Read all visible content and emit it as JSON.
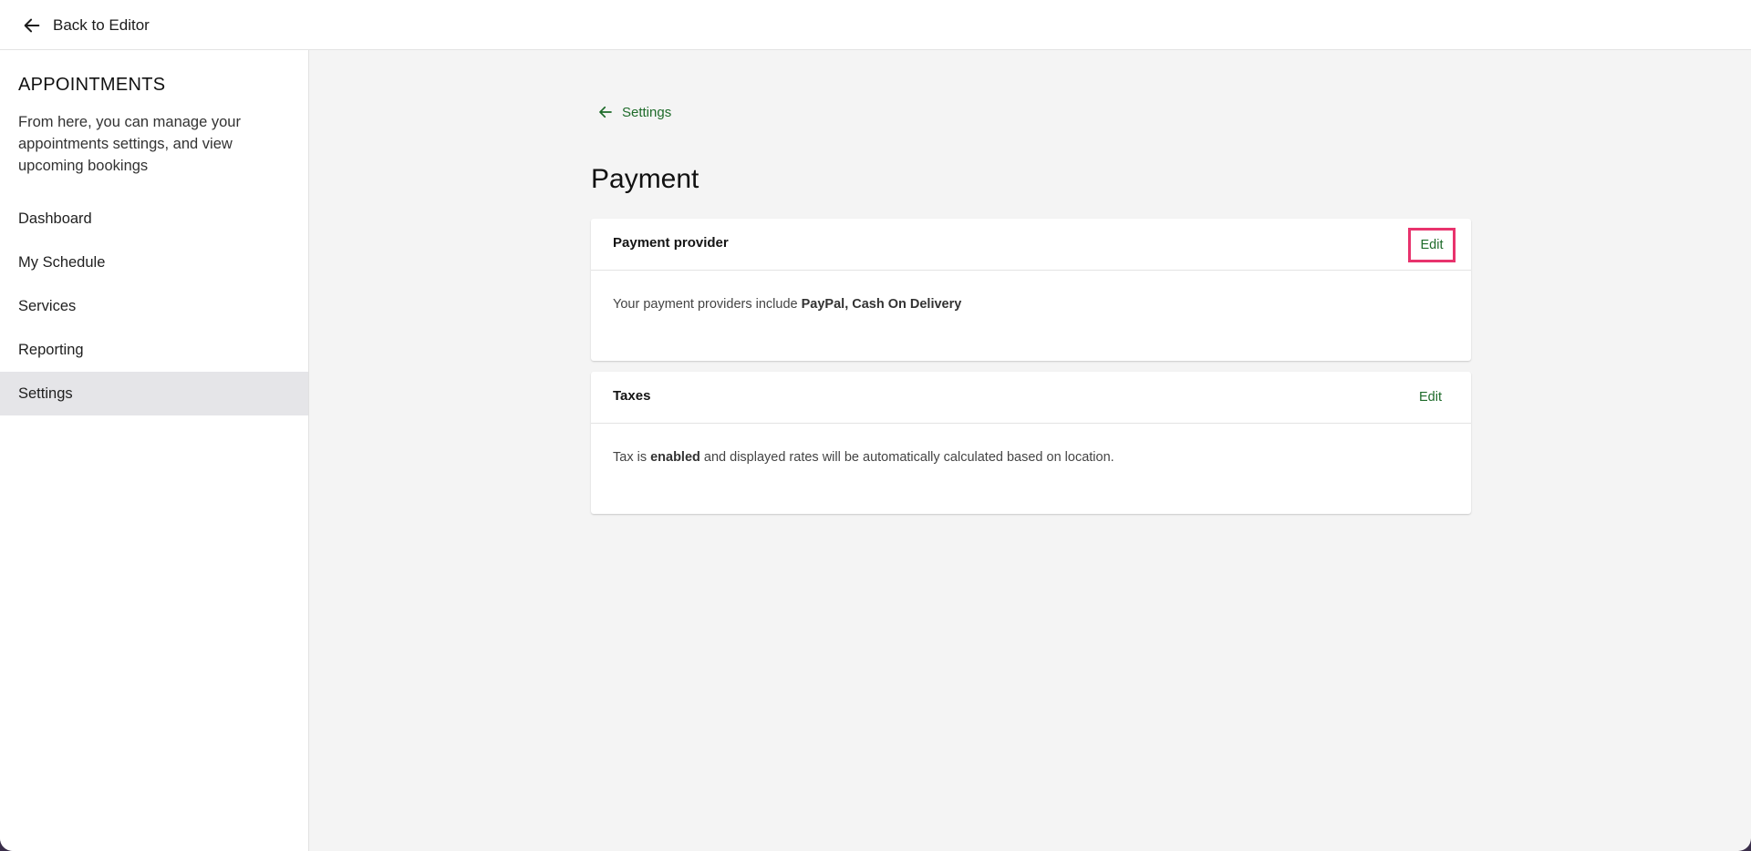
{
  "topbar": {
    "back_label": "Back to Editor"
  },
  "sidebar": {
    "title": "APPOINTMENTS",
    "description": "From here, you can manage your appointments settings, and view upcoming bookings",
    "items": [
      {
        "label": "Dashboard"
      },
      {
        "label": "My Schedule"
      },
      {
        "label": "Services"
      },
      {
        "label": "Reporting"
      },
      {
        "label": "Settings",
        "active": true
      }
    ]
  },
  "main": {
    "breadcrumb": "Settings",
    "title": "Payment",
    "cards": [
      {
        "title": "Payment provider",
        "edit_label": "Edit",
        "body_prefix": "Your payment providers include ",
        "body_bold": "PayPal, Cash On Delivery",
        "body_suffix": ""
      },
      {
        "title": "Taxes",
        "edit_label": "Edit",
        "body_prefix": "Tax is ",
        "body_bold": "enabled",
        "body_suffix": " and displayed rates will be automatically calculated based on location."
      }
    ]
  },
  "colors": {
    "accent_green": "#1e6b2a",
    "highlight_pink": "#e8336d",
    "active_nav_bg": "#e5e5e8",
    "page_bg": "#f4f4f4"
  },
  "icons": {
    "back": "arrow-left-icon",
    "breadcrumb": "arrow-left-icon"
  }
}
